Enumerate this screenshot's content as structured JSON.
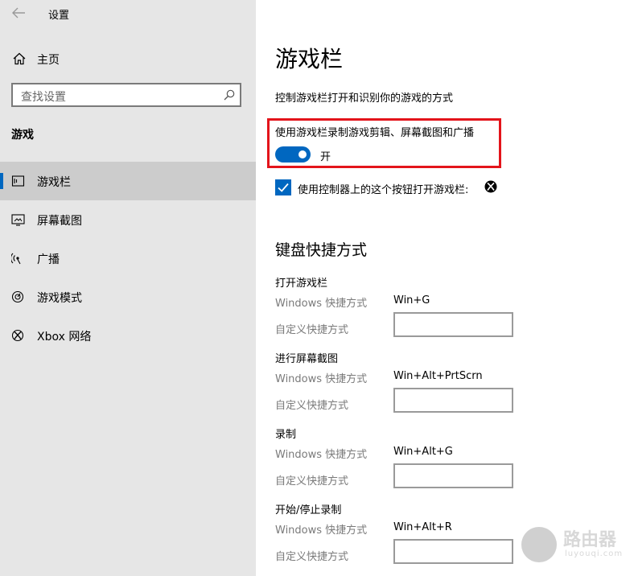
{
  "window": {
    "title": "设置"
  },
  "sidebar": {
    "home_label": "主页",
    "search": {
      "placeholder": "查找设置"
    },
    "section_label": "游戏",
    "items": [
      {
        "label": "游戏栏",
        "icon": "game-bar-icon",
        "selected": true
      },
      {
        "label": "屏幕截图",
        "icon": "screenshot-icon",
        "selected": false
      },
      {
        "label": "广播",
        "icon": "broadcast-icon",
        "selected": false
      },
      {
        "label": "游戏模式",
        "icon": "game-mode-icon",
        "selected": false
      },
      {
        "label": "Xbox 网络",
        "icon": "xbox-icon",
        "selected": false
      }
    ]
  },
  "main": {
    "title": "游戏栏",
    "description": "控制游戏栏打开和识别你的游戏的方式",
    "toggle": {
      "title": "使用游戏栏录制游戏剪辑、屏幕截图和广播",
      "state_label": "开",
      "on": true
    },
    "checkbox": {
      "label": "使用控制器上的这个按钮打开游戏栏:",
      "checked": true
    },
    "shortcuts_title": "键盘快捷方式",
    "shortcut_groups": [
      {
        "title": "打开游戏栏",
        "windows_label": "Windows 快捷方式",
        "windows_value": "Win+G",
        "custom_label": "自定义快捷方式",
        "custom_value": ""
      },
      {
        "title": "进行屏幕截图",
        "windows_label": "Windows 快捷方式",
        "windows_value": "Win+Alt+PrtScrn",
        "custom_label": "自定义快捷方式",
        "custom_value": ""
      },
      {
        "title": "录制",
        "windows_label": "Windows 快捷方式",
        "windows_value": "Win+Alt+G",
        "custom_label": "自定义快捷方式",
        "custom_value": ""
      },
      {
        "title": "开始/停止录制",
        "windows_label": "Windows 快捷方式",
        "windows_value": "Win+Alt+R",
        "custom_label": "自定义快捷方式",
        "custom_value": ""
      }
    ]
  },
  "watermark": {
    "text": "路由器",
    "subtext": "luyouqi.com"
  },
  "colors": {
    "accent": "#0067c0",
    "highlight_border": "#e3141b",
    "sidebar_bg": "#e6e6e6",
    "selected_bg": "#cccccc"
  }
}
